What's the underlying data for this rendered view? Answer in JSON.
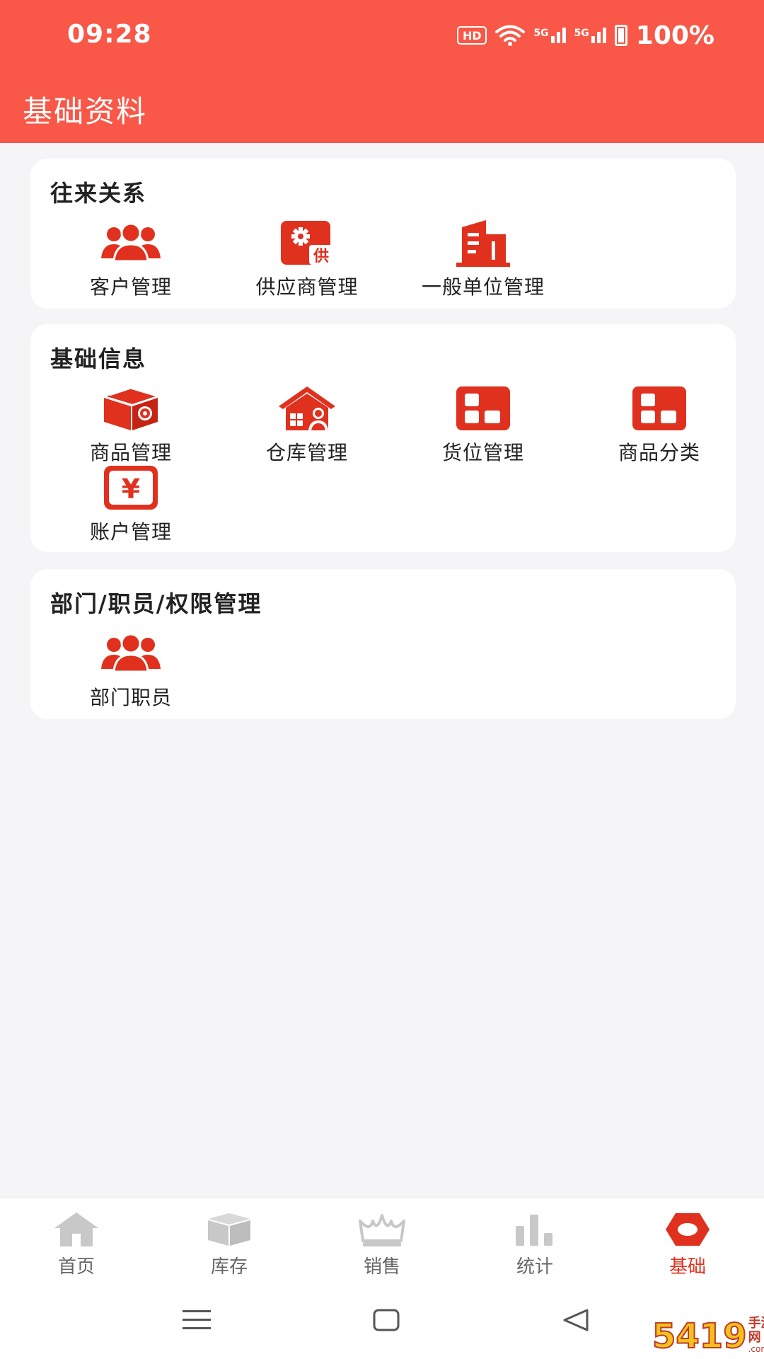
{
  "status_bar": {
    "time": "09:28",
    "hd_badge": "HD",
    "signal_1": "5G",
    "signal_2": "5G",
    "battery": "100%"
  },
  "header": {
    "title": "基础资料"
  },
  "sections": [
    {
      "title": "往来关系",
      "items": [
        {
          "label": "客户管理",
          "icon": "users-icon"
        },
        {
          "label": "供应商管理",
          "icon": "supplier-icon",
          "badge": "供"
        },
        {
          "label": "一般单位管理",
          "icon": "building-icon"
        }
      ]
    },
    {
      "title": "基础信息",
      "items": [
        {
          "label": "商品管理",
          "icon": "box-gear-icon"
        },
        {
          "label": "仓库管理",
          "icon": "warehouse-icon"
        },
        {
          "label": "货位管理",
          "icon": "grid-icon"
        },
        {
          "label": "商品分类",
          "icon": "grid-icon"
        },
        {
          "label": "账户管理",
          "icon": "yuan-icon",
          "glyph": "¥"
        }
      ]
    },
    {
      "title": "部门/职员/权限管理",
      "items": [
        {
          "label": "部门职员",
          "icon": "users-icon"
        }
      ]
    }
  ],
  "bottom_nav": [
    {
      "label": "首页",
      "icon": "home-icon",
      "active": false
    },
    {
      "label": "库存",
      "icon": "box-icon",
      "active": false
    },
    {
      "label": "销售",
      "icon": "crown-icon",
      "active": false
    },
    {
      "label": "统计",
      "icon": "bar-chart-icon",
      "active": false
    },
    {
      "label": "基础",
      "icon": "hexagon-icon",
      "active": true
    }
  ],
  "watermark": {
    "number": "5419",
    "cn": "手游网",
    "en": ".com.cn"
  },
  "colors": {
    "brand": "#f95747",
    "icon_red": "#e0311f",
    "inactive": "#c8c8c8"
  }
}
